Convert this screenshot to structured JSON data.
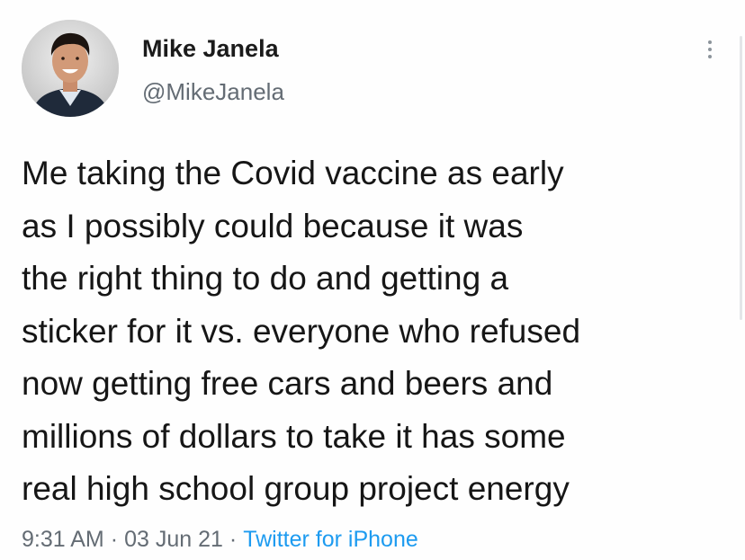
{
  "tweet": {
    "author_name": "Mike Janela",
    "author_handle": "@MikeJanela",
    "text": "Me taking the Covid vaccine as early\nas I possibly could because it was\nthe right thing to do and getting a\nsticker for it vs. everyone who refused\nnow getting free cars and beers and\nmillions of dollars to take it has some\nreal high school group project energy",
    "time": "9:31 AM",
    "date": "03 Jun 21",
    "source": "Twitter for iPhone",
    "separator": "·"
  },
  "icons": {
    "more": "more-options-icon",
    "avatar": "profile-photo"
  },
  "colors": {
    "link": "#1d9bf0",
    "secondary_text": "#646c74",
    "primary_text": "#161616"
  }
}
